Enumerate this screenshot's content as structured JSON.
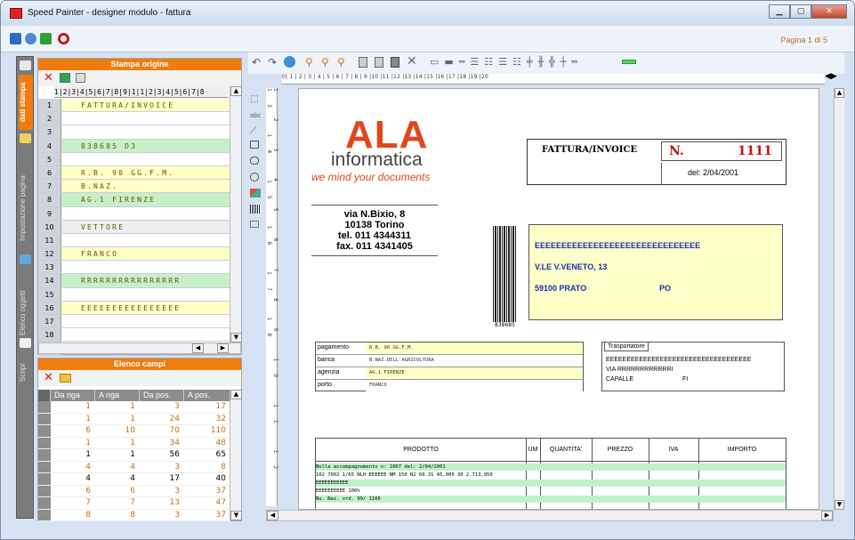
{
  "window": {
    "title": "Speed Painter - designer modulo - fattura"
  },
  "toolbar": {
    "page_indicator": "Pagina 1 di 5"
  },
  "left_tabs": [
    "dati stampa",
    "Impostazione pagina",
    "Elenco oggetti",
    "Script"
  ],
  "stampa_origine": {
    "title": "Stampa origine",
    "column_header": "1|2|3|4|5|6|7|8|9|1|1|2|3|4|5|6|7|8",
    "rows": [
      {
        "num": "1",
        "text": "FATTURA/INVOICE"
      },
      {
        "num": "2",
        "text": ""
      },
      {
        "num": "3",
        "text": ""
      },
      {
        "num": "4",
        "text": "838685              D3"
      },
      {
        "num": "5",
        "text": ""
      },
      {
        "num": "6",
        "text": "R.B.  90 GG.F.M."
      },
      {
        "num": "7",
        "text": "             B.NAZ."
      },
      {
        "num": "8",
        "text": "AG.1 FIRENZE"
      },
      {
        "num": "9",
        "text": ""
      },
      {
        "num": "10",
        "text": "VETTORE"
      },
      {
        "num": "11",
        "text": ""
      },
      {
        "num": "12",
        "text": "FRANCO"
      },
      {
        "num": "13",
        "text": ""
      },
      {
        "num": "14",
        "text": "RRRRRRRRRRRRRRRR"
      },
      {
        "num": "15",
        "text": ""
      },
      {
        "num": "16",
        "text": "EEEEEEEEEEEEEEEE"
      },
      {
        "num": "17",
        "text": ""
      },
      {
        "num": "18",
        "text": ""
      },
      {
        "num": "19",
        "text": ""
      }
    ]
  },
  "elenco_campi": {
    "title": "Elenco campi",
    "headers": [
      "Da riga",
      "A riga",
      "Da pos.",
      "A pos."
    ],
    "rows": [
      [
        "1",
        "1",
        "3",
        "17"
      ],
      [
        "1",
        "1",
        "24",
        "32"
      ],
      [
        "6",
        "10",
        "70",
        "110"
      ],
      [
        "1",
        "1",
        "34",
        "48"
      ],
      [
        "1",
        "1",
        "56",
        "65"
      ],
      [
        "4",
        "4",
        "3",
        "8"
      ],
      [
        "4",
        "4",
        "17",
        "40"
      ],
      [
        "6",
        "6",
        "3",
        "37"
      ],
      [
        "7",
        "7",
        "13",
        "47"
      ],
      [
        "8",
        "8",
        "3",
        "37"
      ]
    ]
  },
  "ruler": {
    "labels": "0| 1 | 2 | 3 | 4 | 5 | 6 | 7 | 8 | 9 |10 |11 |12 |13 |14 |15 |16 |17 |18 |19 |20"
  },
  "vruler": {
    "labels": "1 2 3 4 5 6 7 8 9 10 11 12 13 14 15 16 17 18"
  },
  "invoice": {
    "logo_main": "ALA",
    "logo_sub": "informatica",
    "slogan": "we mind your documents",
    "address_lines": [
      "via N.Bixio, 8",
      "10138 Torino",
      "tel. 011 4344311",
      "fax. 011 4341405"
    ],
    "doc_title": "FATTURA/INVOICE",
    "number_label": "N.",
    "number": "1111",
    "date_line": "del: 2/04/2001",
    "barcode_text": "838685",
    "customer": {
      "name": "EEEEEEEEEEEEEEEEEEEEEEEEEEEEEEE",
      "street": "V.LE V.VENETO, 13",
      "zip_city": "59100 PRATO",
      "province": "PO"
    },
    "payment": [
      {
        "label": "pagamento",
        "value": "R.B. 90 GG.F.M."
      },
      {
        "label": "banca",
        "value": "B.NAZ.DELL'AGRICOLTURA"
      },
      {
        "label": "agenzia",
        "value": "AG.1 FIRENZE"
      },
      {
        "label": "porto",
        "value": "FRANCO"
      }
    ],
    "transport": {
      "title": "Trasportatore",
      "line1": "EEEEEEEEEEEEEEEEEEEEEEEEEEEEEEEEEEE",
      "line2": "VIA RRRRRRRRRRRRI",
      "line3_a": "CAPALLE",
      "line3_b": "FI"
    },
    "product_headers": [
      "PRODOTTO",
      "UM",
      "QUANTITA'",
      "PREZZO",
      "IVA",
      "IMPORTO"
    ],
    "product_rows": [
      "Bolla accompagnamento n:   1667 del: 2/04/2001",
      "102 7002        1/65 NLH EEEEEE NM 150           N2            60.31        45,000           30         2.713,950",
      "                EEEEEEEEEEE",
      "                EEEEEEEEEE 100%",
      "                Nu. Naz. ord. 99/ 1166"
    ]
  }
}
